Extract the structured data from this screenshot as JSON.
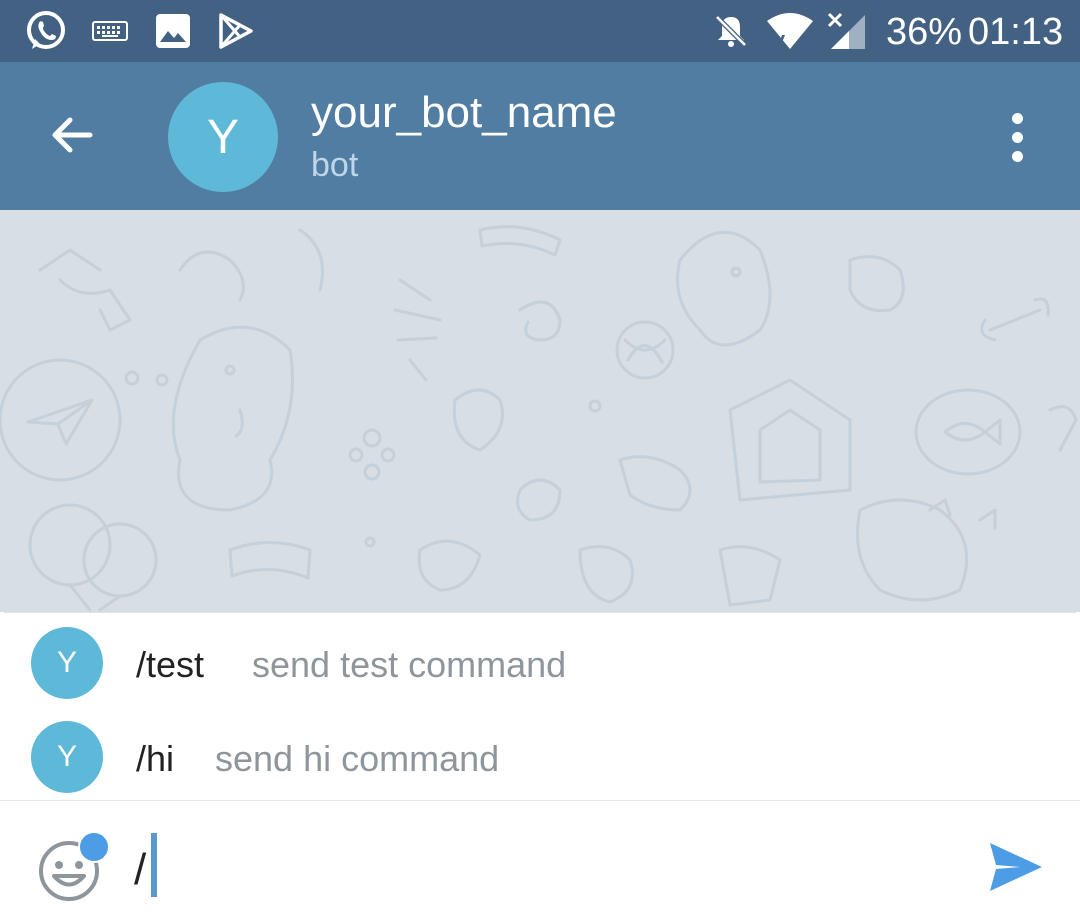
{
  "status_bar": {
    "battery": "36%",
    "time": "01:13",
    "left_icons": [
      "whatsapp-icon",
      "keyboard-icon",
      "image-icon",
      "play-store-icon"
    ],
    "right_icons": [
      "notifications-off-icon",
      "wifi-icon",
      "signal-icon"
    ]
  },
  "header": {
    "avatar_letter": "Y",
    "title": "your_bot_name",
    "subtitle": "bot",
    "back_icon": "arrow-left-icon",
    "menu_icon": "more-vert-icon"
  },
  "suggestions": [
    {
      "avatar_letter": "Y",
      "command": "/test",
      "description": "send test command"
    },
    {
      "avatar_letter": "Y",
      "command": "/hi",
      "description": "send hi command"
    }
  ],
  "input": {
    "value": "/",
    "emoji_icon": "smile-icon",
    "send_icon": "send-icon"
  },
  "colors": {
    "status_bar": "#436283",
    "header": "#517da2",
    "avatar": "#5eb8d8",
    "chat_background": "#d7dee4",
    "accent": "#4c9ce6"
  }
}
